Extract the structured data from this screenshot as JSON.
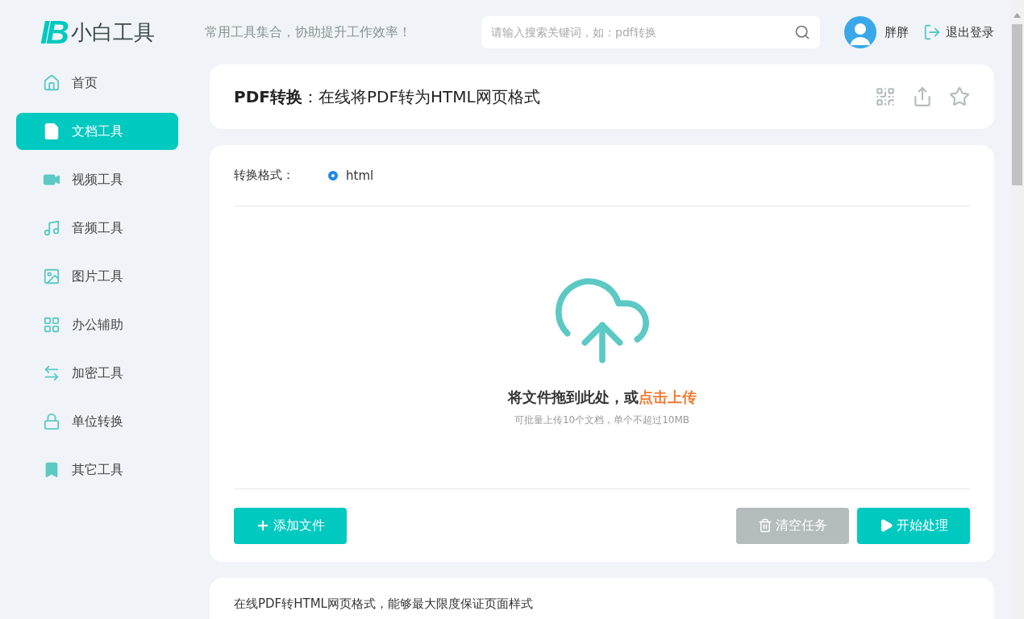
{
  "header": {
    "logo_mark": "IB",
    "logo_text": "小白工具",
    "slogan": "常用工具集合，协助提升工作效率！",
    "search": {
      "placeholder": "请输入搜索关键词，如：pdf转换"
    },
    "user_name": "胖胖",
    "logout": "退出登录"
  },
  "sidebar": {
    "items": [
      {
        "label": "首页",
        "selected": false
      },
      {
        "label": "文档工具",
        "selected": true
      },
      {
        "label": "视频工具",
        "selected": false
      },
      {
        "label": "音频工具",
        "selected": false
      },
      {
        "label": "图片工具",
        "selected": false
      },
      {
        "label": "办公辅助",
        "selected": false
      },
      {
        "label": "加密工具",
        "selected": false
      },
      {
        "label": "单位转换",
        "selected": false
      },
      {
        "label": "其它工具",
        "selected": false
      }
    ]
  },
  "title_card": {
    "title": "**PDF转换**：在线将PDF转为HTML网页格式"
  },
  "converter": {
    "format_label": "转换格式：",
    "formats": [
      {
        "label": "html",
        "selected": true
      }
    ],
    "drop_text": "将文件拖到此处，或",
    "upload_link": "点击上传",
    "hint": "可批量上传10个文档，单个不超过10MB",
    "buttons": [
      {
        "kind": "add",
        "label": "添加文件",
        "disabled": false
      },
      {
        "kind": "clear",
        "label": "清空任务",
        "disabled": true
      },
      {
        "kind": "start",
        "label": "开始处理",
        "disabled": false
      }
    ]
  },
  "description": {
    "text": "在线PDF转HTML网页格式，能够最大限度保证页面样式"
  }
}
